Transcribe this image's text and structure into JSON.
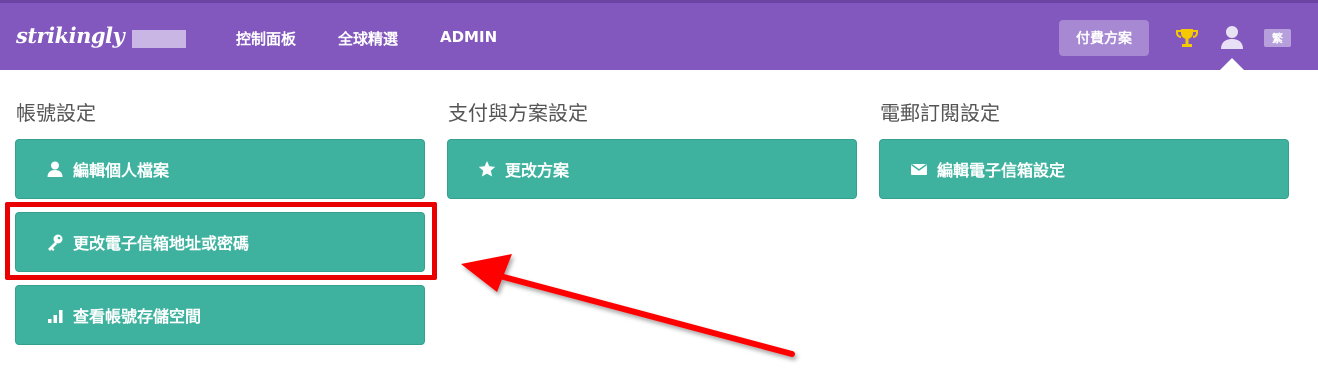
{
  "header": {
    "logo": "strikingly",
    "nav": [
      "控制面板",
      "全球精選",
      "ADMIN"
    ],
    "upgrade_label": "付費方案",
    "lang_label": "繁",
    "bg_color": "#8258be"
  },
  "sections": {
    "account": {
      "title": "帳號設定",
      "buttons": [
        "編輯個人檔案",
        "更改電子信箱地址或密碼",
        "查看帳號存儲空間"
      ]
    },
    "billing": {
      "title": "支付與方案設定",
      "buttons": [
        "更改方案"
      ]
    },
    "email": {
      "title": "電郵訂閱設定",
      "buttons": [
        "編輯電子信箱設定"
      ]
    }
  },
  "icons": {
    "profile": "user-icon",
    "password": "key-icon",
    "storage": "bar-chart-icon",
    "plan": "star-icon",
    "email": "envelope-icon",
    "trophy": "trophy-icon",
    "account": "user-icon"
  },
  "colors": {
    "button": "#3fb29f",
    "highlight": "#e90000"
  }
}
